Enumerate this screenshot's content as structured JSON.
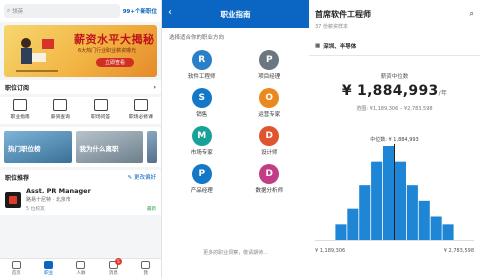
{
  "screen1": {
    "search_label": "领英",
    "badge": "99+个新职位",
    "banner": {
      "headline": "薪资水平大揭秘",
      "sub": "6大热门行业职业薪资曝光",
      "button": "立即查看"
    },
    "subscribe": {
      "title": "职位订阅",
      "more": "›"
    },
    "quick": [
      {
        "label": "职业指南",
        "icon": "guide-icon"
      },
      {
        "label": "薪资查询",
        "icon": "salary-icon"
      },
      {
        "label": "职场问答",
        "icon": "qa-icon"
      },
      {
        "label": "职场必修课",
        "icon": "course-icon"
      }
    ],
    "cards": [
      {
        "text": "热门职位榜"
      },
      {
        "text": "我为什么离职"
      }
    ],
    "recommend": {
      "title": "职位推荐",
      "more": "更改偏好"
    },
    "job": {
      "title": "Asst. PR Manager",
      "company": "路易十尼特 · 北京市",
      "meta": "5 位校友",
      "tag": "最新"
    },
    "tabs": [
      {
        "label": "首页",
        "active": false
      },
      {
        "label": "职业",
        "active": true
      },
      {
        "label": "人脉",
        "active": false
      },
      {
        "label": "消息",
        "active": false,
        "badge": "5"
      },
      {
        "label": "我",
        "active": false
      }
    ]
  },
  "screen2": {
    "back": "‹",
    "title": "职业指南",
    "prompt": "选择适合你的职业方向",
    "items": [
      {
        "letter": "R",
        "label": "软件工程师",
        "color": "#2a80c8"
      },
      {
        "letter": "P",
        "label": "项目经理",
        "color": "#6b7681"
      },
      {
        "letter": "S",
        "label": "销售",
        "color": "#1477c7"
      },
      {
        "letter": "O",
        "label": "运营专家",
        "color": "#ea8a1e"
      },
      {
        "letter": "M",
        "label": "市场专家",
        "color": "#1aa197"
      },
      {
        "letter": "D",
        "label": "设计师",
        "color": "#e0542f"
      },
      {
        "letter": "P",
        "label": "产品经理",
        "color": "#1477c7"
      },
      {
        "letter": "D",
        "label": "数据分析师",
        "color": "#c23c86"
      }
    ],
    "footer": "更多的职业洞察，敬请期待..."
  },
  "screen3": {
    "title": "首席软件工程师",
    "count": "37 份薪资样本",
    "filter": "深圳、半导体",
    "median_label": "薪资中位数",
    "median_value": "¥ 1,884,993",
    "median_unit": "/年",
    "range": "范围: ¥1,189,306 – ¥2,783,598"
  },
  "chart_data": {
    "type": "bar",
    "title": "",
    "xlabel": "",
    "ylabel": "",
    "x_min_label": "¥ 1,189,306",
    "x_max_label": "¥ 2,783,598",
    "median_label": "中位数: ¥ 1,884,993",
    "median_position": 0.5,
    "values": [
      2,
      4,
      7,
      10,
      12,
      10,
      7,
      5,
      3,
      2
    ],
    "bar_color": "#1f86d6",
    "median_color": "#222222"
  }
}
